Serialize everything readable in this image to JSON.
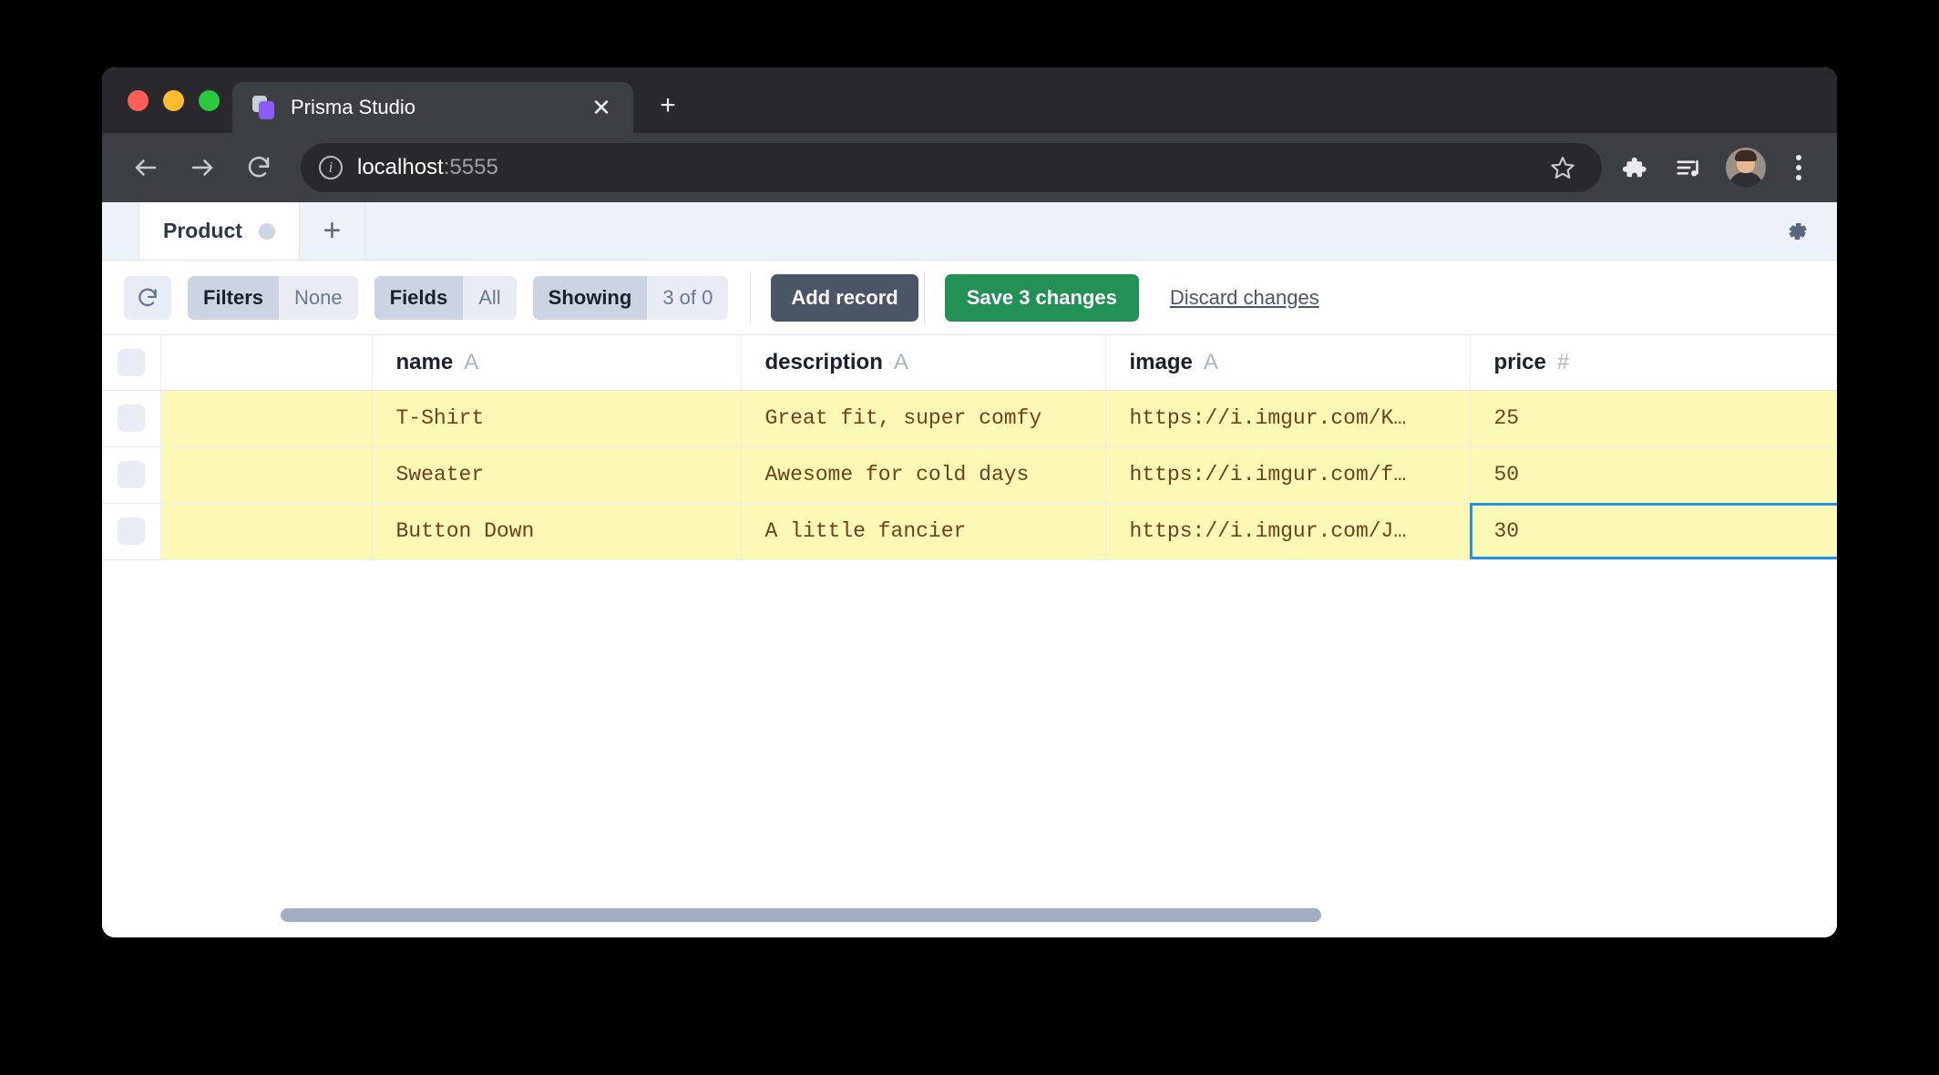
{
  "browser": {
    "tab": {
      "title": "Prisma Studio",
      "favicon_name": "prisma-studio-favicon",
      "close_label": "✕"
    },
    "new_tab_label": "+",
    "omnibox": {
      "host": "localhost",
      "port": ":5555",
      "info_icon_label": "i"
    },
    "toolbar_icons": [
      "star-icon",
      "extensions-puzzle-icon",
      "media-playlist-icon",
      "profile-avatar",
      "more-menu-icon"
    ]
  },
  "studio": {
    "tabs": [
      {
        "label": "Product",
        "active": true
      }
    ],
    "add_tab_label": "+",
    "settings_icon": "gear-icon",
    "toolbar": {
      "refresh_icon": "refresh-icon",
      "filters_label": "Filters",
      "filters_value": "None",
      "fields_label": "Fields",
      "fields_value": "All",
      "showing_label": "Showing",
      "showing_value": "3 of 0",
      "add_record_label": "Add record",
      "save_label": "Save 3 changes",
      "discard_label": "Discard changes",
      "accent_green": "#239155",
      "accent_dark": "#4a5568"
    },
    "grid": {
      "columns": [
        {
          "key": "check",
          "label": "",
          "type": ""
        },
        {
          "key": "id",
          "label": "",
          "type": ""
        },
        {
          "key": "name",
          "label": "name",
          "type": "A"
        },
        {
          "key": "description",
          "label": "description",
          "type": "A"
        },
        {
          "key": "image",
          "label": "image",
          "type": "A"
        },
        {
          "key": "price",
          "label": "price",
          "type": "#"
        }
      ],
      "rows": [
        {
          "id": "",
          "name": "T-Shirt",
          "description": "Great fit, super comfy",
          "image": "https://i.imgur.com/K…",
          "price": "25",
          "modified": true,
          "price_selected": false
        },
        {
          "id": "",
          "name": "Sweater",
          "description": "Awesome for cold days",
          "image": "https://i.imgur.com/f…",
          "price": "50",
          "modified": true,
          "price_selected": false
        },
        {
          "id": "",
          "name": "Button Down",
          "description": "A little fancier",
          "image": "https://i.imgur.com/J…",
          "price": "30",
          "modified": true,
          "price_selected": true
        }
      ],
      "modified_row_color": "#fcf8b6",
      "selected_cell_border": "#2491e8",
      "cell_text_color": "#70401c"
    }
  }
}
